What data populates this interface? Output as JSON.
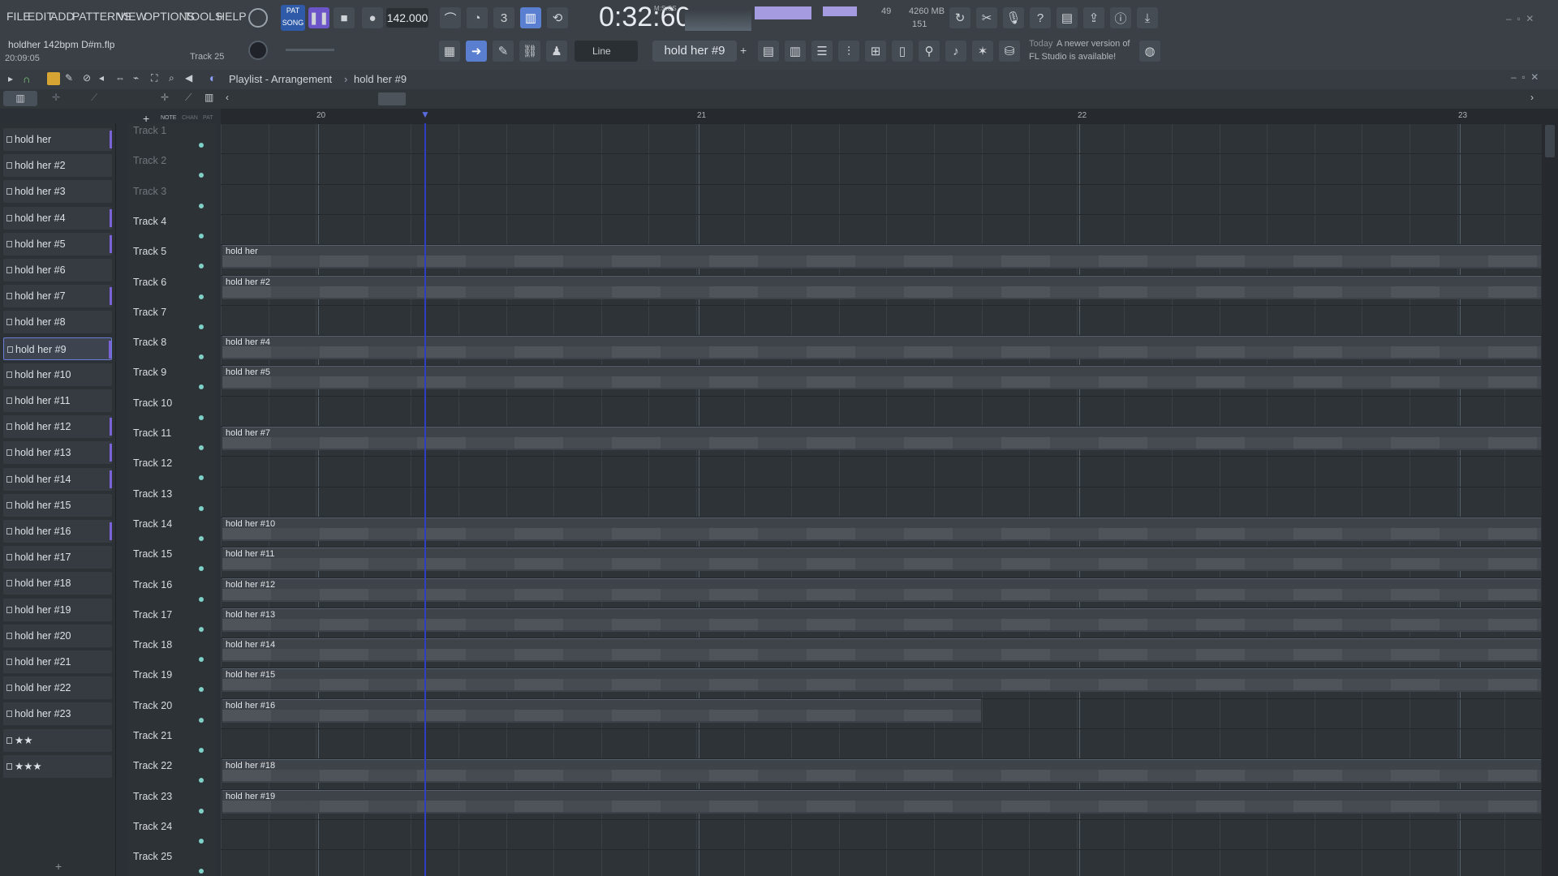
{
  "menu": [
    "FILE",
    "EDIT",
    "ADD",
    "PATTERNS",
    "VIEW",
    "OPTIONS",
    "TOOLS",
    "HELP"
  ],
  "transport": {
    "mode_top": "PAT",
    "mode_bottom": "SONG",
    "tempo": "142.000",
    "time": "0:32:60",
    "time_unit": "M:S:CS"
  },
  "status": {
    "project": "holdher 142bpm D#m.flp",
    "time": "20:09:05",
    "track": "Track 25",
    "cpu": "49",
    "mem": "4260 MB",
    "poly": "151"
  },
  "snap": "Line",
  "pattern_selector": "hold her #9",
  "news": {
    "day": "Today",
    "line1": "A newer version of",
    "line2": "FL Studio is available!"
  },
  "breadcrumb": {
    "a": "Playlist - Arrangement",
    "b": "hold her #9"
  },
  "ruler": [
    "20",
    "21",
    "22",
    "23"
  ],
  "picker": [
    "hold her",
    "hold her #2",
    "hold her #3",
    "hold her #4",
    "hold her #5",
    "hold her #6",
    "hold her #7",
    "hold her #8",
    "hold her #9",
    "hold her #10",
    "hold her #11",
    "hold her #12",
    "hold her #13",
    "hold her #14",
    "hold her #15",
    "hold her #16",
    "hold her #17",
    "hold her #18",
    "hold her #19",
    "hold her #20",
    "hold her #21",
    "hold her #22",
    "hold her #23",
    "★★",
    "★★★"
  ],
  "tracks": [
    "Track 1",
    "Track 2",
    "Track 3",
    "Track 4",
    "Track 5",
    "Track 6",
    "Track 7",
    "Track 8",
    "Track 9",
    "Track 10",
    "Track 11",
    "Track 12",
    "Track 13",
    "Track 14",
    "Track 15",
    "Track 16",
    "Track 17",
    "Track 18",
    "Track 19",
    "Track 20",
    "Track 21",
    "Track 22",
    "Track 23",
    "Track 24",
    "Track 25"
  ],
  "clips": {
    "track5": "hold her",
    "track6": "hold her #2",
    "track8": "hold her #4",
    "track9": "hold her #5",
    "track11": "hold her #7",
    "track14": "hold her #10",
    "track15": "hold her #11",
    "track16": "hold her #12",
    "track17": "hold her #13",
    "track18": "hold her #14",
    "track19": "hold her #15",
    "track20": "hold her #16",
    "track22": "hold her #18",
    "track23": "hold her #19"
  }
}
